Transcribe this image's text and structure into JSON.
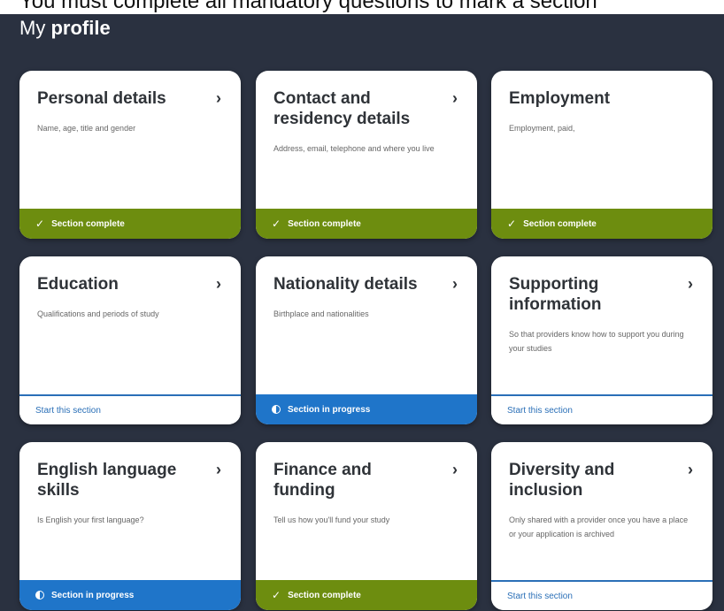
{
  "banner": {
    "text": "You must complete all mandatory questions to mark a section"
  },
  "page": {
    "title_prefix": "My",
    "title_strong": "profile"
  },
  "cards": [
    {
      "title": "Personal details",
      "description": "Name, age, title and gender",
      "status": "Section complete"
    },
    {
      "title": "Contact and residency details",
      "description": "Address, email, telephone and where you live",
      "status": "Section complete"
    },
    {
      "title": "Employment",
      "description": "Employment, paid,",
      "status": "Section complete"
    },
    {
      "title": "Education",
      "description": "Qualifications and periods of study",
      "status": "Start this section"
    },
    {
      "title": "Nationality details",
      "description": "Birthplace and nationalities",
      "status": "Section in progress"
    },
    {
      "title": "Supporting information",
      "description": "So that providers know how to support you during your studies",
      "status": "Start this section"
    },
    {
      "title": "English language skills",
      "description": "Is English your first language?",
      "status": "Section in progress"
    },
    {
      "title": "Finance and funding",
      "description": "Tell us how you'll fund your study",
      "status": "Section complete"
    },
    {
      "title": "Diversity and inclusion",
      "description": "Only shared with a provider once you have a place or your application is archived",
      "status": "Start this section"
    }
  ],
  "icons": {
    "chevron": "›",
    "check": "✓"
  },
  "colors": {
    "complete": "#6d8d0f",
    "in_progress": "#1f75c9",
    "start_link": "#2a6fb7",
    "background": "#2a3140"
  }
}
